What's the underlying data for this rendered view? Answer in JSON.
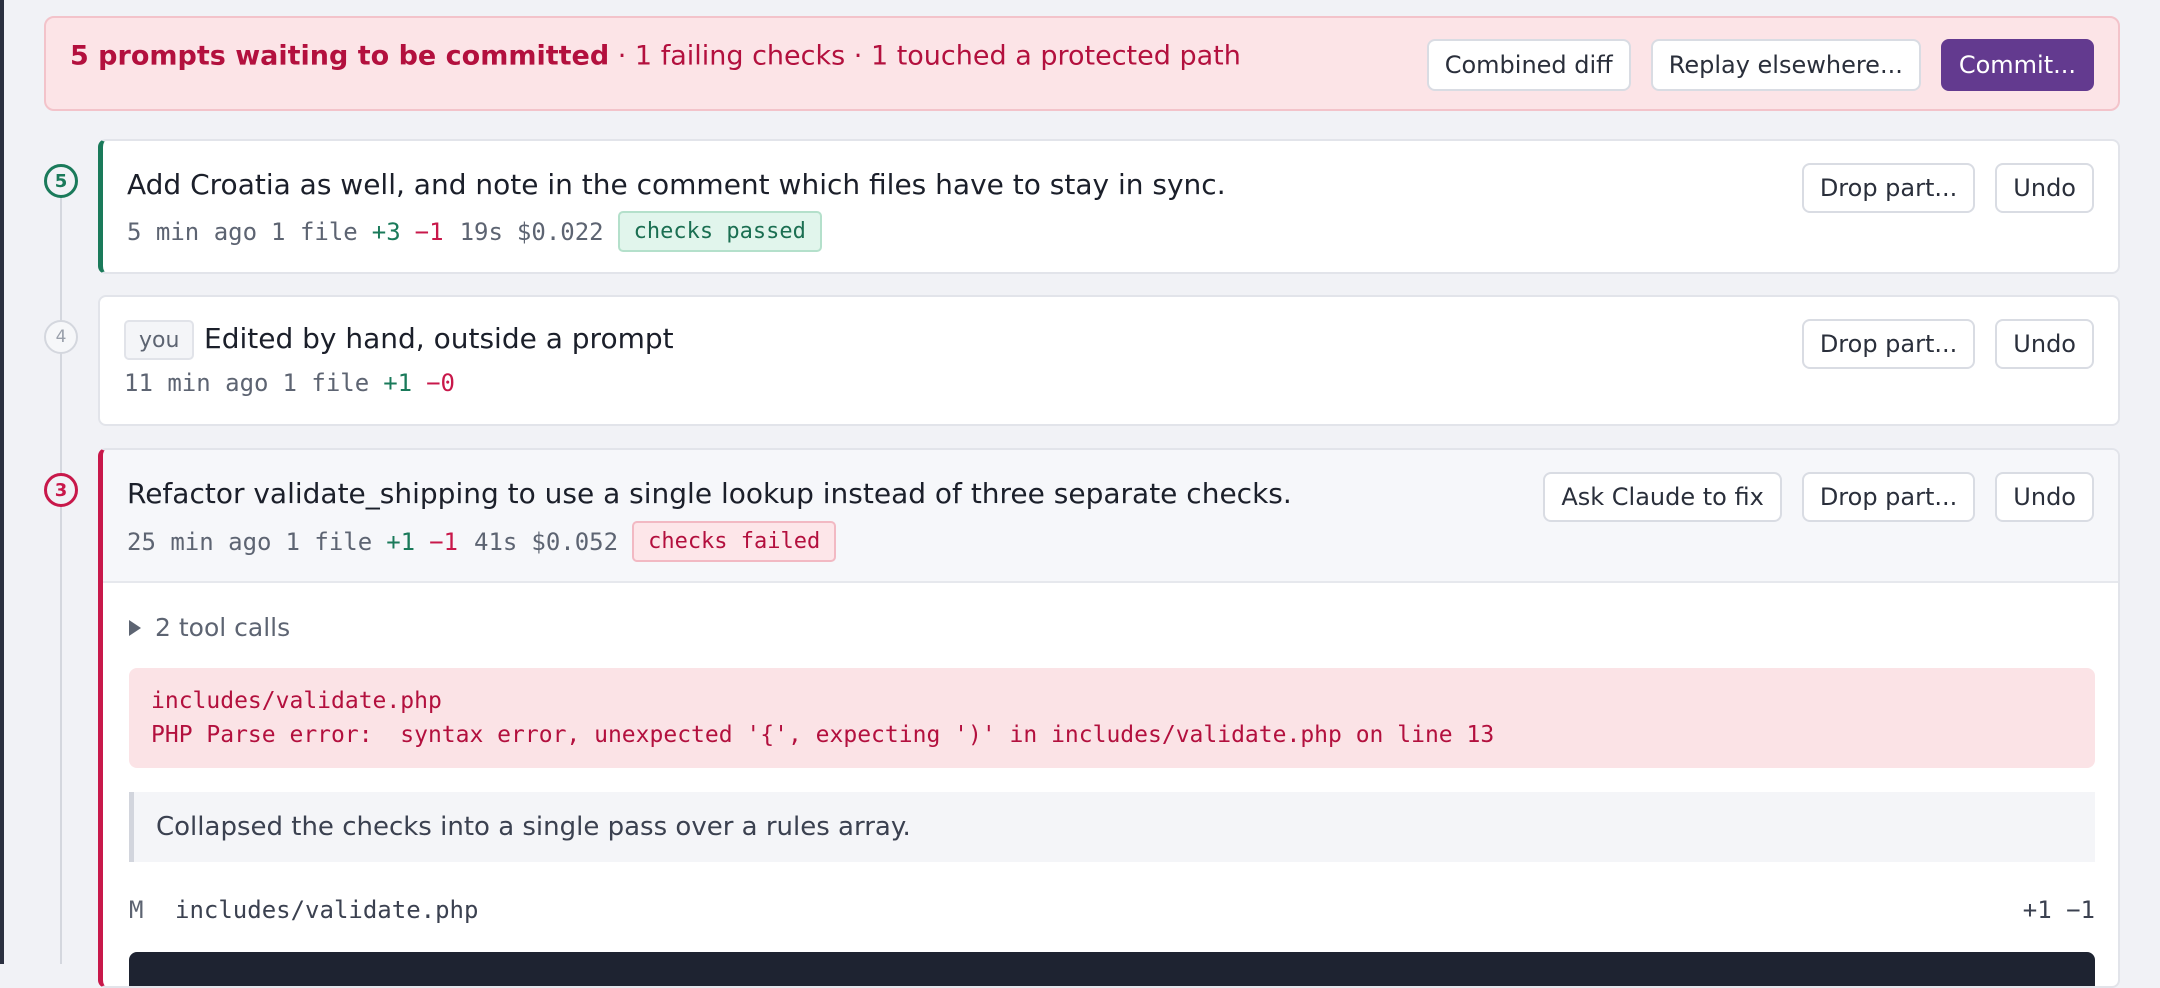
{
  "banner": {
    "headline": "5 prompts waiting to be committed",
    "details": "· 1 failing checks · 1 touched a protected path",
    "actions": {
      "combined_diff": "Combined diff",
      "replay": "Replay elsewhere...",
      "commit": "Commit..."
    }
  },
  "prompts": [
    {
      "number": "5",
      "title": "Add Croatia as well, and note in the comment which files have to stay in sync.",
      "time": "5 min ago",
      "files": "1 file",
      "additions": "+3",
      "deletions": "−1",
      "duration": "19s",
      "cost": "$0.022",
      "status": "checks passed",
      "actions": {
        "drop": "Drop part...",
        "undo": "Undo"
      }
    },
    {
      "number": "4",
      "author_chip": "you",
      "title": "Edited by hand, outside a prompt",
      "time": "11 min ago",
      "files": "1 file",
      "additions": "+1",
      "deletions": "−0",
      "actions": {
        "drop": "Drop part...",
        "undo": "Undo"
      }
    },
    {
      "number": "3",
      "title": "Refactor validate_shipping to use a single lookup instead of three separate checks.",
      "time": "25 min ago",
      "files": "1 file",
      "additions": "+1",
      "deletions": "−1",
      "duration": "41s",
      "cost": "$0.052",
      "status": "checks failed",
      "actions": {
        "fix": "Ask Claude to fix",
        "drop": "Drop part...",
        "undo": "Undo"
      },
      "tool_calls": "2 tool calls",
      "error": {
        "file": "includes/validate.php",
        "message": "PHP Parse error:  syntax error, unexpected '{', expecting ')' in includes/validate.php on line 13"
      },
      "summary": "Collapsed the checks into a single pass over a rules array.",
      "changed_file": {
        "status": "M",
        "path": "includes/validate.php",
        "stats": "+1 −1"
      }
    }
  ],
  "colors": {
    "accent": "#633a8f",
    "pass": "#1a7a5a",
    "fail": "#c8184a",
    "banner_bg": "#fce4e7"
  }
}
